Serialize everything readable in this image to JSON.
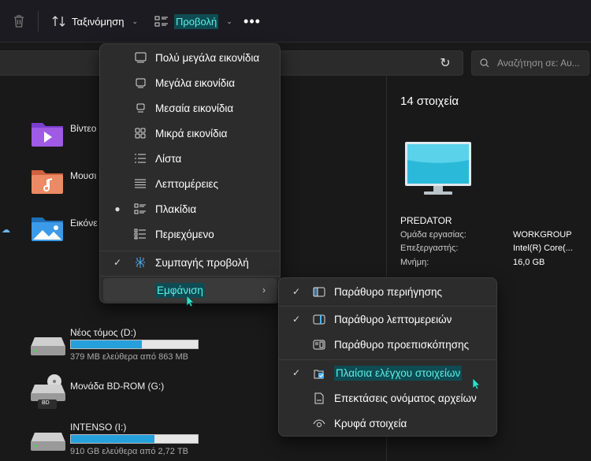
{
  "toolbar": {
    "sort_label": "Ταξινόμηση",
    "view_label": "Προβολή",
    "more_label": "•••"
  },
  "search": {
    "placeholder": "Αναζήτηση σε: Αυ..."
  },
  "folders": [
    {
      "label": "Βίντεο"
    },
    {
      "label": "Μουσι"
    },
    {
      "label": "Εικόνε"
    }
  ],
  "drives": [
    {
      "name": "Νέος τόμος (D:)",
      "free": "379 MB ελεύθερα από 863 MB",
      "used_fraction": 0.56
    },
    {
      "name": "Μονάδα BD-ROM (G:)",
      "badge": "BD"
    },
    {
      "name": "INTENSO (I:)",
      "free": "910 GB ελεύθερα από 2,72 TB",
      "used_fraction": 0.66
    }
  ],
  "details": {
    "count": "14 στοιχεία",
    "computer_name": "PREDATOR",
    "rows": [
      {
        "label": "Ομάδα εργασίας:",
        "value": "WORKGROUP"
      },
      {
        "label": "Επεξεργαστής:",
        "value": "Intel(R) Core(..."
      },
      {
        "label": "Μνήμη:",
        "value": "16,0 GB"
      }
    ]
  },
  "view_menu": {
    "items": [
      {
        "label": "Πολύ μεγάλα εικονίδια",
        "icon": "extra-large-icons-icon"
      },
      {
        "label": "Μεγάλα εικονίδια",
        "icon": "large-icons-icon"
      },
      {
        "label": "Μεσαία εικονίδια",
        "icon": "medium-icons-icon"
      },
      {
        "label": "Μικρά εικονίδια",
        "icon": "small-icons-icon"
      },
      {
        "label": "Λίστα",
        "icon": "list-icon"
      },
      {
        "label": "Λεπτομέρειες",
        "icon": "details-icon"
      },
      {
        "label": "Πλακίδια",
        "icon": "tiles-icon",
        "selected": true
      },
      {
        "label": "Περιεχόμενο",
        "icon": "content-icon"
      }
    ],
    "compact_label": "Συμπαγής προβολή",
    "show_label": "Εμφάνιση"
  },
  "show_menu": {
    "items": [
      {
        "label": "Παράθυρο περιήγησης",
        "checked": true
      },
      {
        "label": "Παράθυρο λεπτομερειών",
        "checked": true
      },
      {
        "label": "Παράθυρο προεπισκόπησης",
        "checked": false
      },
      {
        "label": "Πλαίσια ελέγχου στοιχείων",
        "checked": true
      },
      {
        "label": "Επεκτάσεις ονόματος αρχείων",
        "checked": false
      },
      {
        "label": "Κρυφά στοιχεία",
        "checked": false
      }
    ]
  },
  "colors": {
    "highlight_bg": "#0e4b52",
    "highlight_text": "#5ff0e6",
    "drive_bar": "#26a0da"
  }
}
